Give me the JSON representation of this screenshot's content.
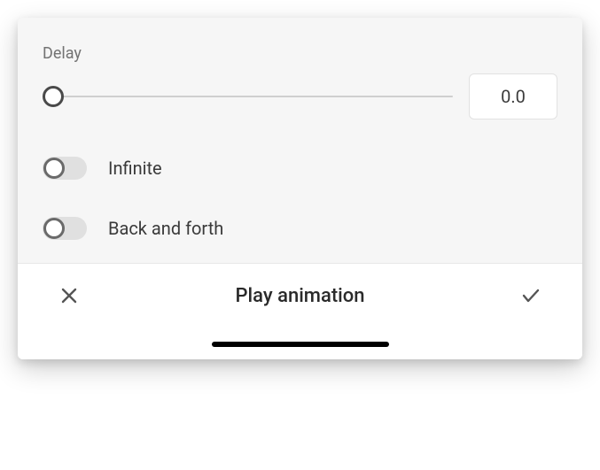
{
  "delay": {
    "label": "Delay",
    "value": "0.0"
  },
  "toggles": {
    "infinite": {
      "label": "Infinite",
      "on": false
    },
    "back_and_forth": {
      "label": "Back and forth",
      "on": false
    }
  },
  "footer": {
    "title": "Play animation"
  }
}
